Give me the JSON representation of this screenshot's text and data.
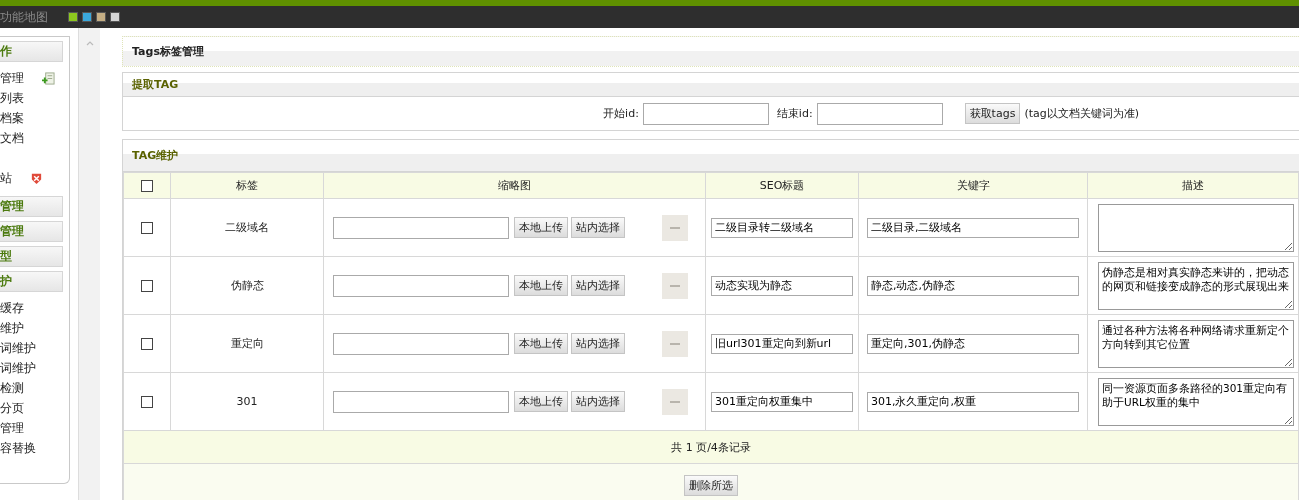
{
  "top_bar": {
    "title": "功能地图",
    "swatches": [
      {
        "color": "#8cc61e"
      },
      {
        "color": "#3ba8dc"
      },
      {
        "color": "#c4ae84"
      },
      {
        "color": "#d4d4d4"
      }
    ]
  },
  "sidebar": {
    "sections": [
      {
        "title": "作",
        "items": [
          {
            "kind": "add",
            "label": "管理"
          },
          {
            "kind": "text",
            "label": "列表"
          },
          {
            "kind": "text",
            "label": "档案"
          },
          {
            "kind": "text",
            "label": "文档"
          },
          {
            "kind": "spacer"
          },
          {
            "kind": "remove",
            "label": "站"
          }
        ]
      },
      {
        "title": "管理"
      },
      {
        "title": "管理"
      },
      {
        "title": "型"
      },
      {
        "title": "护",
        "items": [
          {
            "kind": "text",
            "label": "缓存"
          },
          {
            "kind": "text",
            "label": "维护"
          },
          {
            "kind": "text",
            "label": "词维护"
          },
          {
            "kind": "text",
            "label": "词维护"
          },
          {
            "kind": "text",
            "label": "检测"
          },
          {
            "kind": "text",
            "label": "分页"
          },
          {
            "kind": "text",
            "label": "管理"
          },
          {
            "kind": "text",
            "label": "容替换"
          }
        ]
      }
    ]
  },
  "page_title": "Tags标签管理",
  "fetch_panel": {
    "title": "提取TAG",
    "start_label": "开始id:",
    "end_label": "结束id:",
    "button": "获取tags",
    "note": "(tag以文档关键词为准)"
  },
  "tag_panel": {
    "title": "TAG维护",
    "columns": [
      "标签",
      "缩略图",
      "SEO标题",
      "关键字",
      "描述"
    ],
    "select_all": {
      "checked": false
    },
    "rows": [
      {
        "checked": false,
        "tag": "二级域名",
        "upload_button": "本地上传",
        "select_button": "站内选择",
        "seo_title": "二级目录转二级域名",
        "keywords": "二级目录,二级域名"
      },
      {
        "checked": false,
        "tag": "伪静态",
        "upload_button": "本地上传",
        "select_button": "站内选择",
        "seo_title": "动态实现为静态",
        "keywords": "静态,动态,伪静态",
        "description": "伪静态是相对真实静态来讲的，把动态的网页和链接变成静态的形式展现出来"
      },
      {
        "checked": false,
        "tag": "重定向",
        "upload_button": "本地上传",
        "select_button": "站内选择",
        "seo_title": "旧url301重定向到新url",
        "keywords": "重定向,301,伪静态",
        "description": "通过各种方法将各种网络请求重新定个方向转到其它位置"
      },
      {
        "checked": false,
        "tag": "301",
        "upload_button": "本地上传",
        "select_button": "站内选择",
        "seo_title": "301重定向权重集中",
        "keywords": "301,永久重定向,权重",
        "description": "同一资源页面多条路径的301重定向有助于URL权重的集中"
      }
    ],
    "pager": "共 1 页/4条记录",
    "delete_button": "删除所选"
  }
}
